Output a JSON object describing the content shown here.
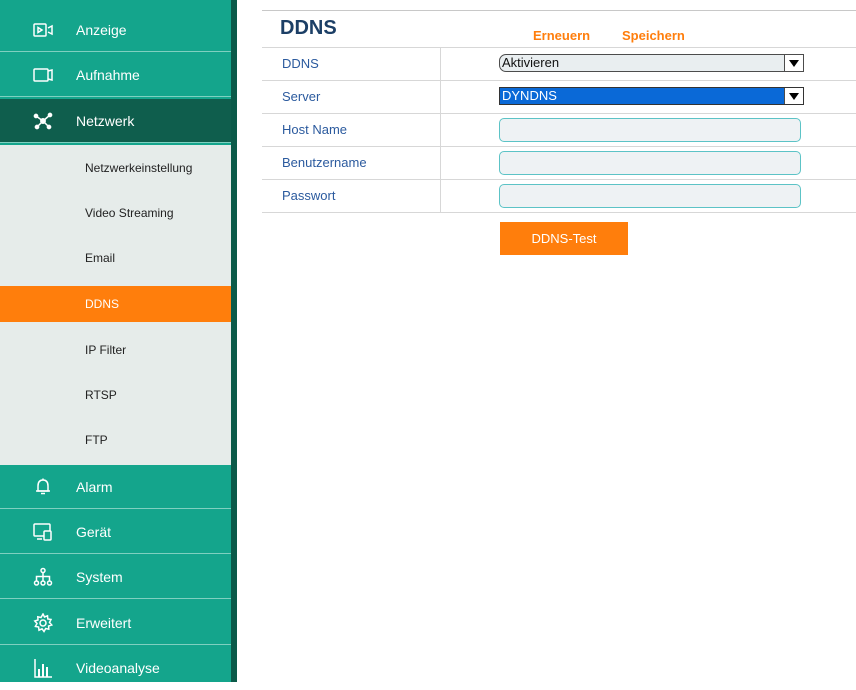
{
  "sidebar": {
    "items": [
      {
        "label": "Anzeige",
        "icon": "display-icon"
      },
      {
        "label": "Aufnahme",
        "icon": "recording-icon"
      },
      {
        "label": "Netzwerk",
        "icon": "network-icon"
      },
      {
        "label": "Alarm",
        "icon": "bell-icon"
      },
      {
        "label": "Gerät",
        "icon": "device-icon"
      },
      {
        "label": "System",
        "icon": "system-icon"
      },
      {
        "label": "Erweitert",
        "icon": "gear-icon"
      },
      {
        "label": "Videoanalyse",
        "icon": "bar-chart-icon"
      }
    ],
    "active_item": "Netzwerk",
    "sub_items": [
      {
        "label": "Netzwerkeinstellung"
      },
      {
        "label": "Video Streaming"
      },
      {
        "label": "Email"
      },
      {
        "label": "DDNS"
      },
      {
        "label": "IP Filter"
      },
      {
        "label": "RTSP"
      },
      {
        "label": "FTP"
      }
    ],
    "active_sub_item": "DDNS"
  },
  "main": {
    "title": "DDNS",
    "refresh_label": "Erneuern",
    "save_label": "Speichern",
    "fields": {
      "ddns": {
        "label": "DDNS",
        "value": "Aktivieren"
      },
      "server": {
        "label": "Server",
        "value": "DYNDNS"
      },
      "host_name": {
        "label": "Host Name",
        "value": ""
      },
      "username": {
        "label": "Benutzername",
        "value": ""
      },
      "password": {
        "label": "Passwort",
        "value": ""
      }
    },
    "test_button_label": "DDNS-Test"
  },
  "colors": {
    "sidebar": "#14a58c",
    "sidebar_active": "#0f5e4d",
    "accent": "#ff7e0c",
    "title": "#1c3f66",
    "label": "#2b5a9e"
  }
}
